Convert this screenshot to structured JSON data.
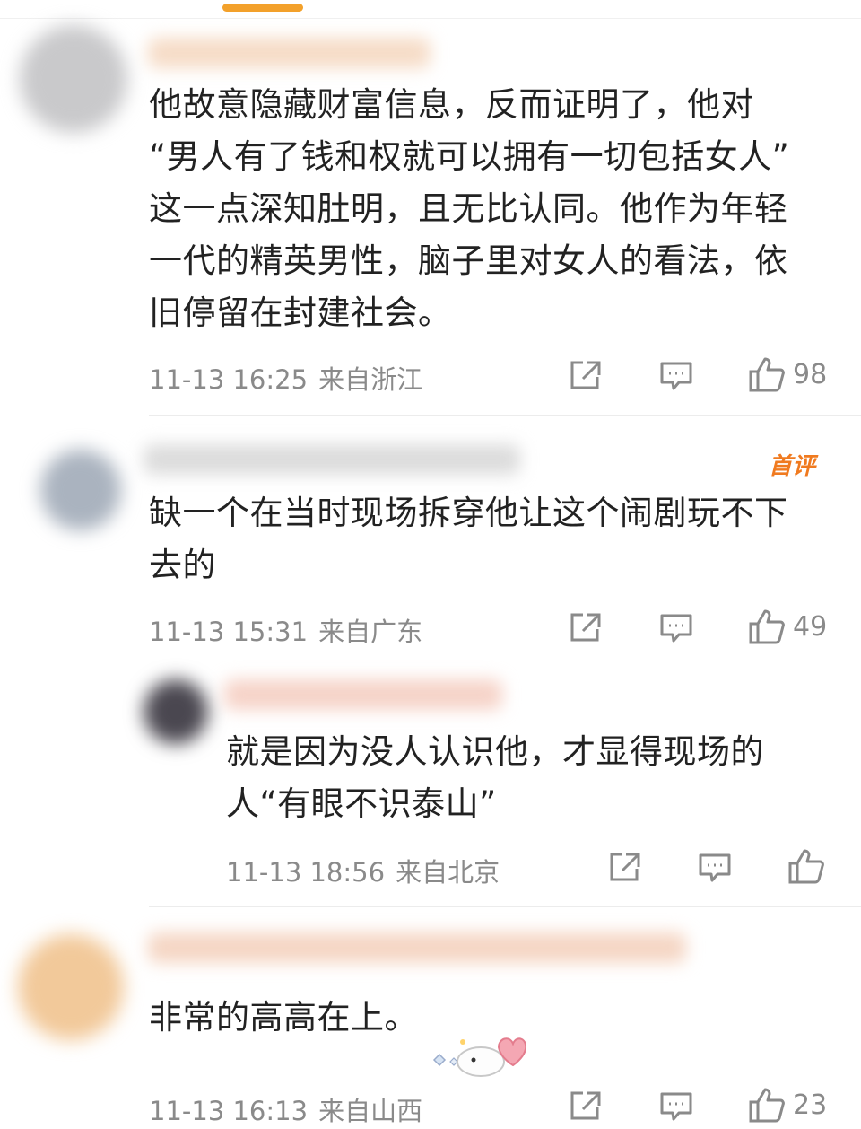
{
  "comments": [
    {
      "text_lines": [
        "他故意隐藏财富信息，反而证明了，他对",
        "“男人有了钱和权就可以拥有一切包括女人”",
        "这一点深知肚明，且无比认同。他作为年轻",
        "一代的精英男性，脑子里对女人的看法，依",
        "旧停留在封建社会。"
      ],
      "time": "11-13 16:25",
      "location": "来自浙江",
      "likes": "98"
    },
    {
      "badge": "首评",
      "text_lines": [
        "缺一个在当时现场拆穿他让这个闹剧玩不下",
        "去的"
      ],
      "time": "11-13 15:31",
      "location": "来自广东",
      "likes": "49"
    },
    {
      "text_lines": [
        "就是因为没人认识他，才显得现场的",
        "人“有眼不识泰山”"
      ],
      "time": "11-13 18:56",
      "location": "来自北京",
      "likes": ""
    },
    {
      "text_lines": [
        "非常的高高在上。"
      ],
      "time": "11-13 16:13",
      "location": "来自山西",
      "likes": "23"
    }
  ],
  "colors": {
    "accent": "#f3a12b",
    "meta": "#8a8a8a",
    "badge": "#f07a1f"
  },
  "icons": [
    "share-icon",
    "comment-icon",
    "like-icon"
  ]
}
